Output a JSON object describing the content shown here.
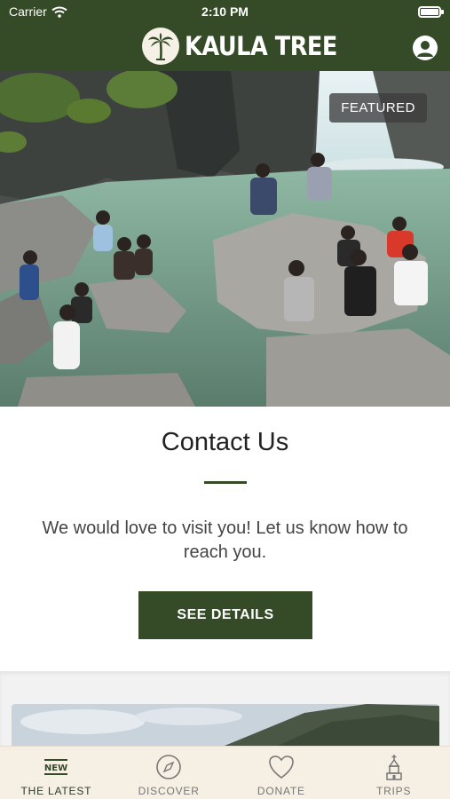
{
  "status_bar": {
    "carrier": "Carrier",
    "time": "2:10 PM"
  },
  "header": {
    "brand": "KAULA TREE",
    "logo_icon": "palm-tree-icon",
    "profile_icon": "user-profile-icon",
    "color": "#354a26"
  },
  "hero": {
    "badge": "FEATURED"
  },
  "contact": {
    "title": "Contact Us",
    "text": "We would love to visit you! Let us know how to reach you.",
    "button": "SEE DETAILS"
  },
  "tabs": [
    {
      "label": "THE LATEST",
      "icon": "new-badge-icon",
      "active": true
    },
    {
      "label": "DISCOVER",
      "icon": "compass-icon",
      "active": false
    },
    {
      "label": "DONATE",
      "icon": "heart-icon",
      "active": false
    },
    {
      "label": "TRIPS",
      "icon": "church-icon",
      "active": false
    }
  ],
  "colors": {
    "primary": "#354a26",
    "tabbar_bg": "#f6efe3"
  }
}
